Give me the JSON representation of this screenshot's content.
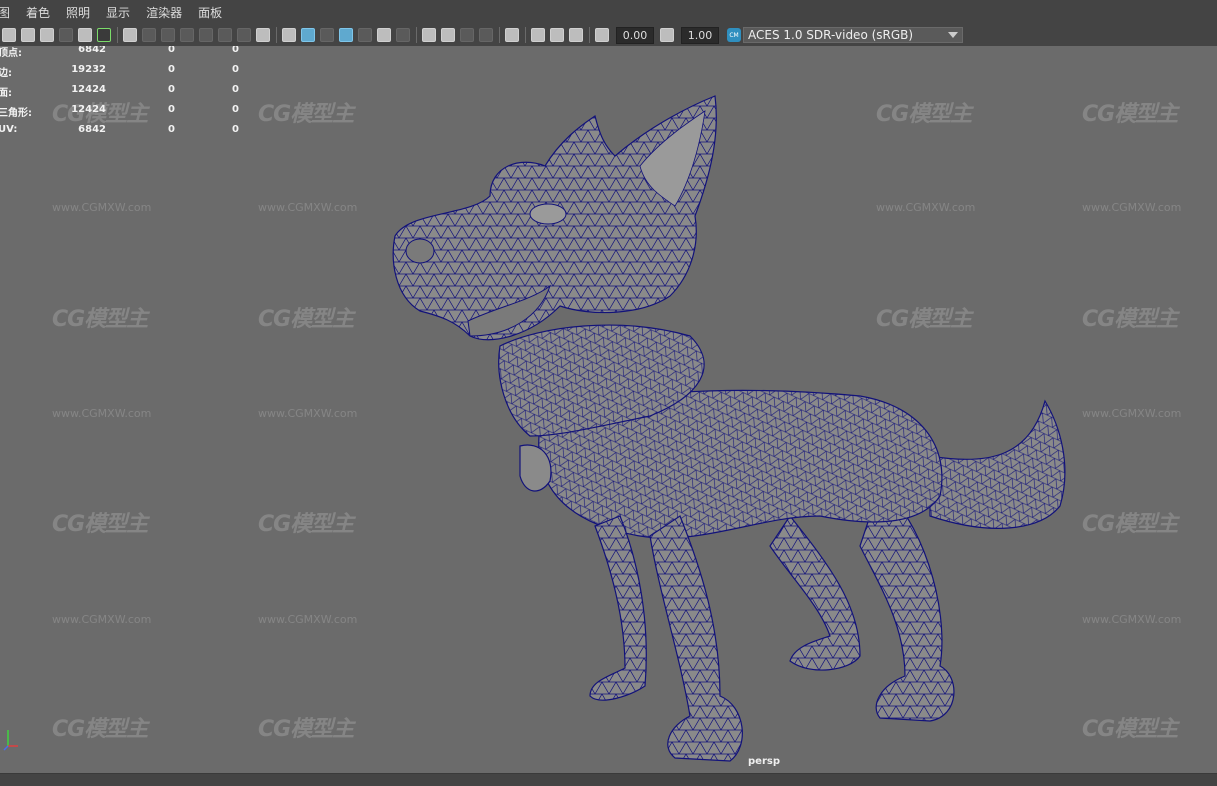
{
  "menu": [
    "图",
    "着色",
    "照明",
    "显示",
    "渲染器",
    "面板"
  ],
  "toolbar": {
    "exposure_value": "0.00",
    "gamma_value": "1.00",
    "colorspace_badge": "CM",
    "colorspace_label": "ACES 1.0 SDR-video (sRGB)"
  },
  "hud": {
    "rows": [
      {
        "label": "顶点:",
        "v1": "6842",
        "v2": "0",
        "v3": "0"
      },
      {
        "label": "边:",
        "v1": "19232",
        "v2": "0",
        "v3": "0"
      },
      {
        "label": "面:",
        "v1": "12424",
        "v2": "0",
        "v3": "0"
      },
      {
        "label": "三角形:",
        "v1": "12424",
        "v2": "0",
        "v3": "0"
      },
      {
        "label": "UV:",
        "v1": "6842",
        "v2": "0",
        "v3": "0"
      }
    ]
  },
  "watermark": {
    "logo": "CG模型主",
    "url": "www.CGMXW.com"
  },
  "viewport": {
    "camera_label": "persp"
  },
  "colors": {
    "wire": "#12127a",
    "mesh_fill": "#8a8a8a",
    "viewport_bg": "#6b6b6b",
    "accent": "#5fa9cf"
  }
}
